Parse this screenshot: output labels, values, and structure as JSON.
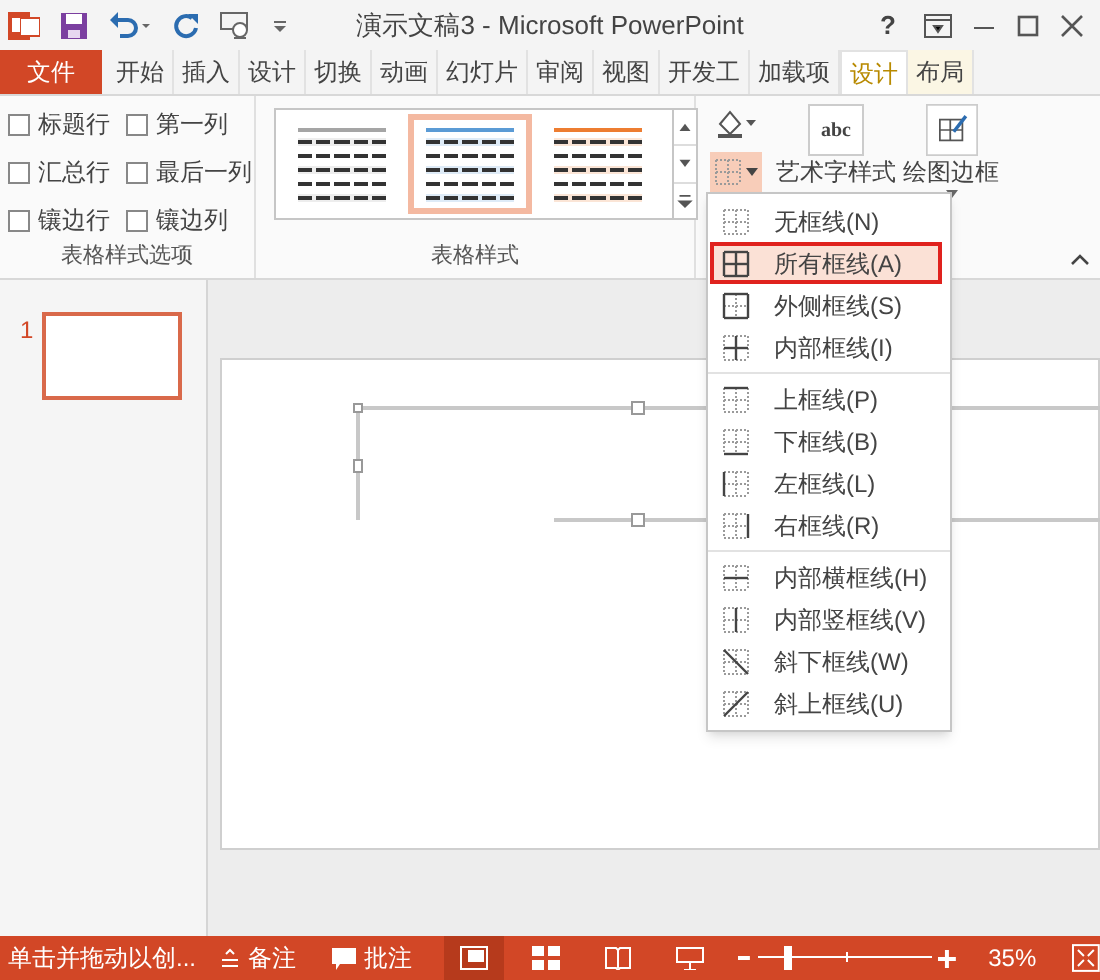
{
  "window": {
    "title": "演示文稿3 - Microsoft PowerPoint",
    "help": "?"
  },
  "file_tab": "文件",
  "tabs": [
    {
      "label": "开始",
      "selected": false,
      "contextual": false
    },
    {
      "label": "插入",
      "selected": false,
      "contextual": false
    },
    {
      "label": "设计",
      "selected": false,
      "contextual": false
    },
    {
      "label": "切换",
      "selected": false,
      "contextual": false
    },
    {
      "label": "动画",
      "selected": false,
      "contextual": false
    },
    {
      "label": "幻灯片",
      "selected": false,
      "contextual": false
    },
    {
      "label": "审阅",
      "selected": false,
      "contextual": false
    },
    {
      "label": "视图",
      "selected": false,
      "contextual": false
    },
    {
      "label": "开发工",
      "selected": false,
      "contextual": false
    },
    {
      "label": "加载项",
      "selected": false,
      "contextual": false
    },
    {
      "label": "设计",
      "selected": true,
      "contextual": true
    },
    {
      "label": "布局",
      "selected": false,
      "contextual": true
    }
  ],
  "style_options": {
    "label": "表格样式选项",
    "items": [
      {
        "label": "标题行",
        "checked": false
      },
      {
        "label": "第一列",
        "checked": false
      },
      {
        "label": "汇总行",
        "checked": false
      },
      {
        "label": "最后一列",
        "checked": false
      },
      {
        "label": "镶边行",
        "checked": false
      },
      {
        "label": "镶边列",
        "checked": false
      }
    ]
  },
  "table_styles": {
    "label": "表格样式",
    "styles": [
      {
        "color": "#a5a5a5",
        "selected": false
      },
      {
        "color": "#5b9bd5",
        "selected": true
      },
      {
        "color": "#ed7d31",
        "selected": false
      }
    ]
  },
  "wordart": {
    "icon_text": "abc",
    "label": "艺术字样式"
  },
  "draw_borders": {
    "label": "绘图边框"
  },
  "border_menu": [
    [
      {
        "label": "无框线(N)",
        "kind": "none",
        "selected": false
      },
      {
        "label": "所有框线(A)",
        "kind": "all",
        "selected": true
      },
      {
        "label": "外侧框线(S)",
        "kind": "outside",
        "selected": false
      },
      {
        "label": "内部框线(I)",
        "kind": "inside",
        "selected": false
      }
    ],
    [
      {
        "label": "上框线(P)",
        "kind": "top",
        "selected": false
      },
      {
        "label": "下框线(B)",
        "kind": "bottom",
        "selected": false
      },
      {
        "label": "左框线(L)",
        "kind": "left",
        "selected": false
      },
      {
        "label": "右框线(R)",
        "kind": "right",
        "selected": false
      }
    ],
    [
      {
        "label": "内部横框线(H)",
        "kind": "inside_h",
        "selected": false
      },
      {
        "label": "内部竖框线(V)",
        "kind": "inside_v",
        "selected": false
      },
      {
        "label": "斜下框线(W)",
        "kind": "diag_down",
        "selected": false
      },
      {
        "label": "斜上框线(U)",
        "kind": "diag_up",
        "selected": false
      }
    ]
  ],
  "slides": [
    {
      "number": "1",
      "selected": true
    }
  ],
  "status_bar": {
    "hint": "单击并拖动以创...",
    "notes": "备注",
    "comments": "批注",
    "views": [
      {
        "kind": "normal",
        "selected": true
      },
      {
        "kind": "sorter",
        "selected": false
      },
      {
        "kind": "reading",
        "selected": false
      },
      {
        "kind": "slideshow",
        "selected": false
      }
    ],
    "zoom": {
      "level": 0.17,
      "reading": "35%"
    }
  }
}
